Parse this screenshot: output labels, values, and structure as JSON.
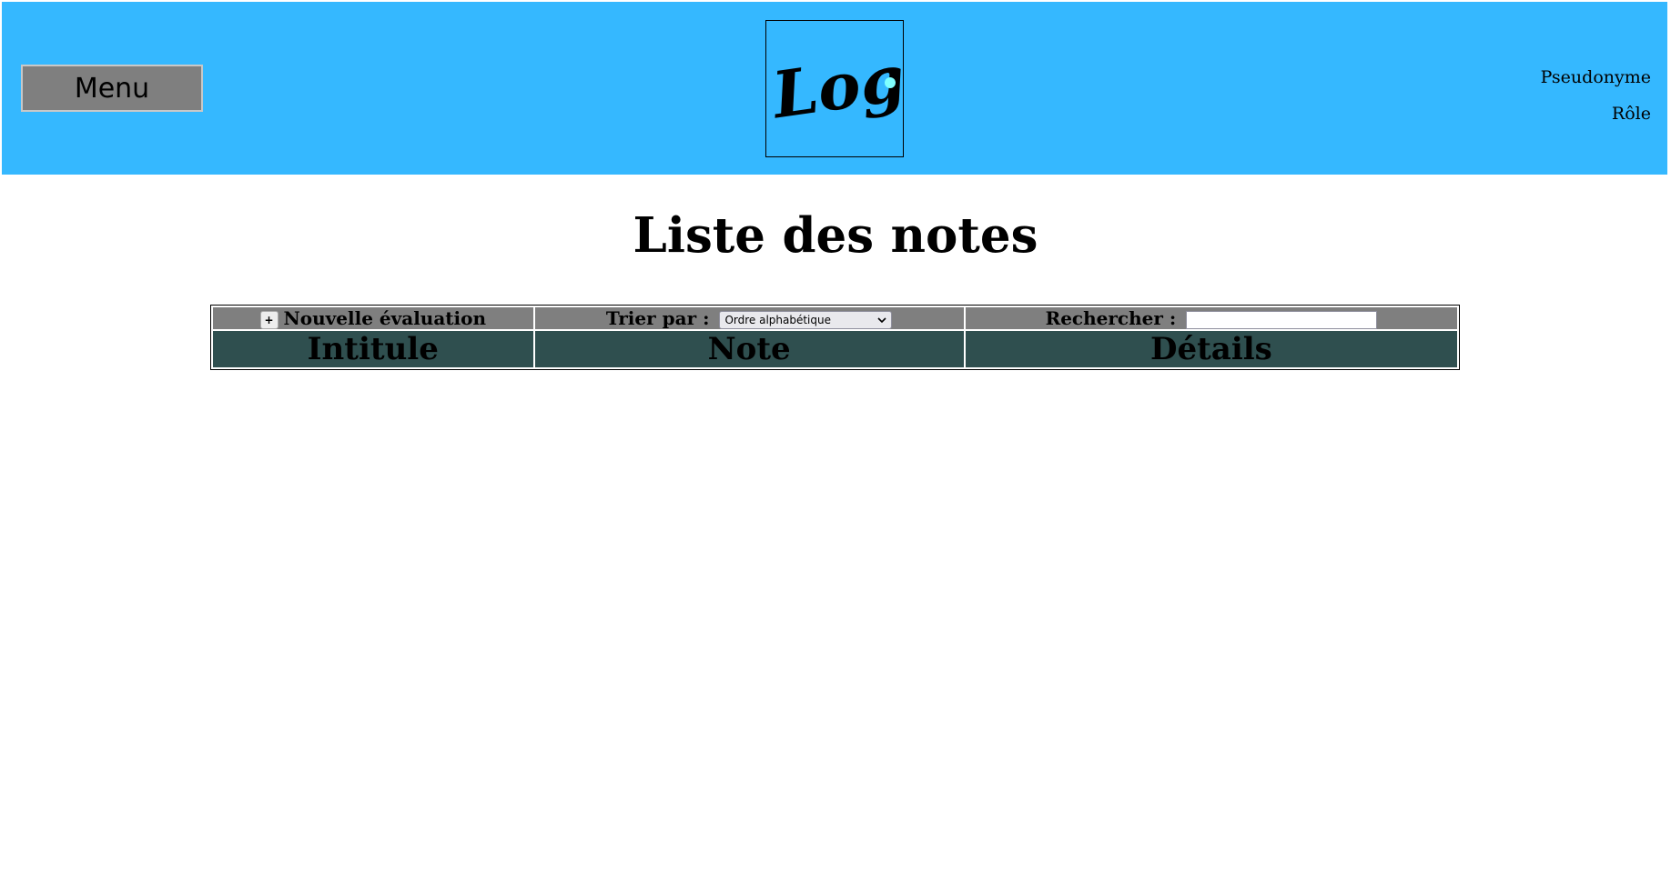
{
  "header": {
    "menu_label": "Menu",
    "logo_text": "Logo",
    "user": {
      "pseudonym": "Pseudonyme",
      "role": "Rôle"
    }
  },
  "page": {
    "title": "Liste des notes"
  },
  "toolbar": {
    "add_button_label": "+",
    "new_evaluation_label": "Nouvelle évaluation",
    "sort_label": "Trier par :",
    "sort_selected": "Ordre alphabétique",
    "search_label": "Rechercher :",
    "search_value": ""
  },
  "table": {
    "columns": [
      "Intitule",
      "Note",
      "Détails"
    ]
  },
  "colors": {
    "header_bg": "#35b8ff",
    "toolbar_bg": "#7f7f7f",
    "column_header_bg": "#2f4f4f"
  }
}
